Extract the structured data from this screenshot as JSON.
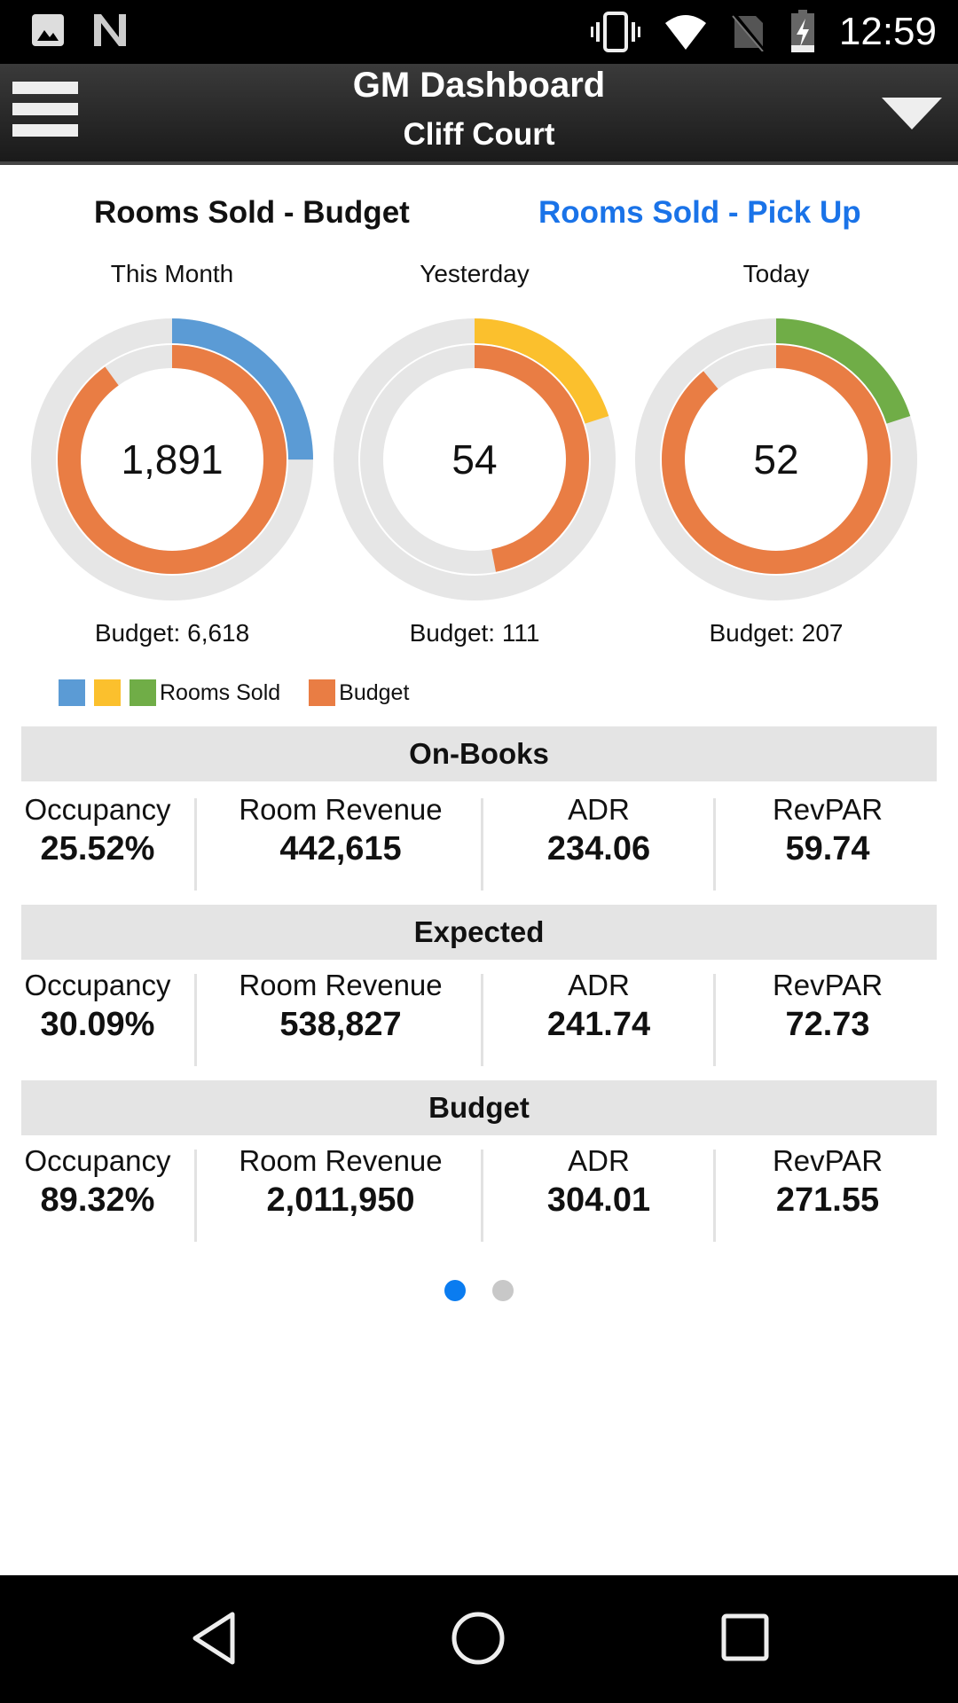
{
  "status_bar": {
    "time": "12:59",
    "left_icons": [
      "image-notification-icon",
      "n-notification-icon"
    ],
    "right_icons": [
      "vibrate-icon",
      "wifi-icon",
      "no-sim-icon",
      "battery-charging-icon"
    ]
  },
  "app_bar": {
    "title": "GM Dashboard",
    "subtitle": "Cliff Court",
    "menu_icon": "hamburger-menu-icon",
    "dropdown_icon": "dropdown-triangle-icon"
  },
  "tabs": [
    {
      "label": "Rooms Sold - Budget",
      "active": true
    },
    {
      "label": "Rooms Sold - Pick Up",
      "active": false
    }
  ],
  "colors": {
    "accent_blue": "#1a73e8",
    "this_month": "#5b9bd5",
    "yesterday": "#fbc02d",
    "today": "#70ad47",
    "budget": "#e97d44",
    "track": "#e6e6e6",
    "section_bg": "#e4e4e4",
    "dot_active": "#0a7cf0",
    "dot_inactive": "#c8c8c8"
  },
  "chart_data": {
    "type": "pie",
    "title": "Rooms Sold - Budget",
    "legend": [
      {
        "label": "Rooms Sold",
        "colors": [
          "#5b9bd5",
          "#fbc02d",
          "#70ad47"
        ]
      },
      {
        "label": "Budget",
        "colors": [
          "#e97d44"
        ]
      }
    ],
    "legend_position": "bottom-left",
    "charts": [
      {
        "period": "This Month",
        "rooms_sold": 1891,
        "rooms_sold_label": "1,891",
        "budget": 6618,
        "budget_label": "Budget: 6,618",
        "outer_fraction": 0.25,
        "inner_fraction": 0.9,
        "color": "#5b9bd5"
      },
      {
        "period": "Yesterday",
        "rooms_sold": 54,
        "rooms_sold_label": "54",
        "budget": 111,
        "budget_label": "Budget: 111",
        "outer_fraction": 0.2,
        "inner_fraction": 0.47,
        "color": "#fbc02d"
      },
      {
        "period": "Today",
        "rooms_sold": 52,
        "rooms_sold_label": "52",
        "budget": 207,
        "budget_label": "Budget: 207",
        "outer_fraction": 0.2,
        "inner_fraction": 0.89,
        "color": "#70ad47"
      }
    ]
  },
  "sections": [
    {
      "title": "On-Books",
      "metrics": [
        {
          "label": "Occupancy",
          "value": "25.52%"
        },
        {
          "label": "Room Revenue",
          "value": "442,615"
        },
        {
          "label": "ADR",
          "value": "234.06"
        },
        {
          "label": "RevPAR",
          "value": "59.74"
        }
      ]
    },
    {
      "title": "Expected",
      "metrics": [
        {
          "label": "Occupancy",
          "value": "30.09%"
        },
        {
          "label": "Room Revenue",
          "value": "538,827"
        },
        {
          "label": "ADR",
          "value": "241.74"
        },
        {
          "label": "RevPAR",
          "value": "72.73"
        }
      ]
    },
    {
      "title": "Budget",
      "metrics": [
        {
          "label": "Occupancy",
          "value": "89.32%"
        },
        {
          "label": "Room Revenue",
          "value": "2,011,950"
        },
        {
          "label": "ADR",
          "value": "304.01"
        },
        {
          "label": "RevPAR",
          "value": "271.55"
        }
      ]
    }
  ],
  "pager": {
    "pages": 2,
    "current": 1
  },
  "nav_bar": [
    "back-icon",
    "home-icon",
    "recents-icon"
  ]
}
